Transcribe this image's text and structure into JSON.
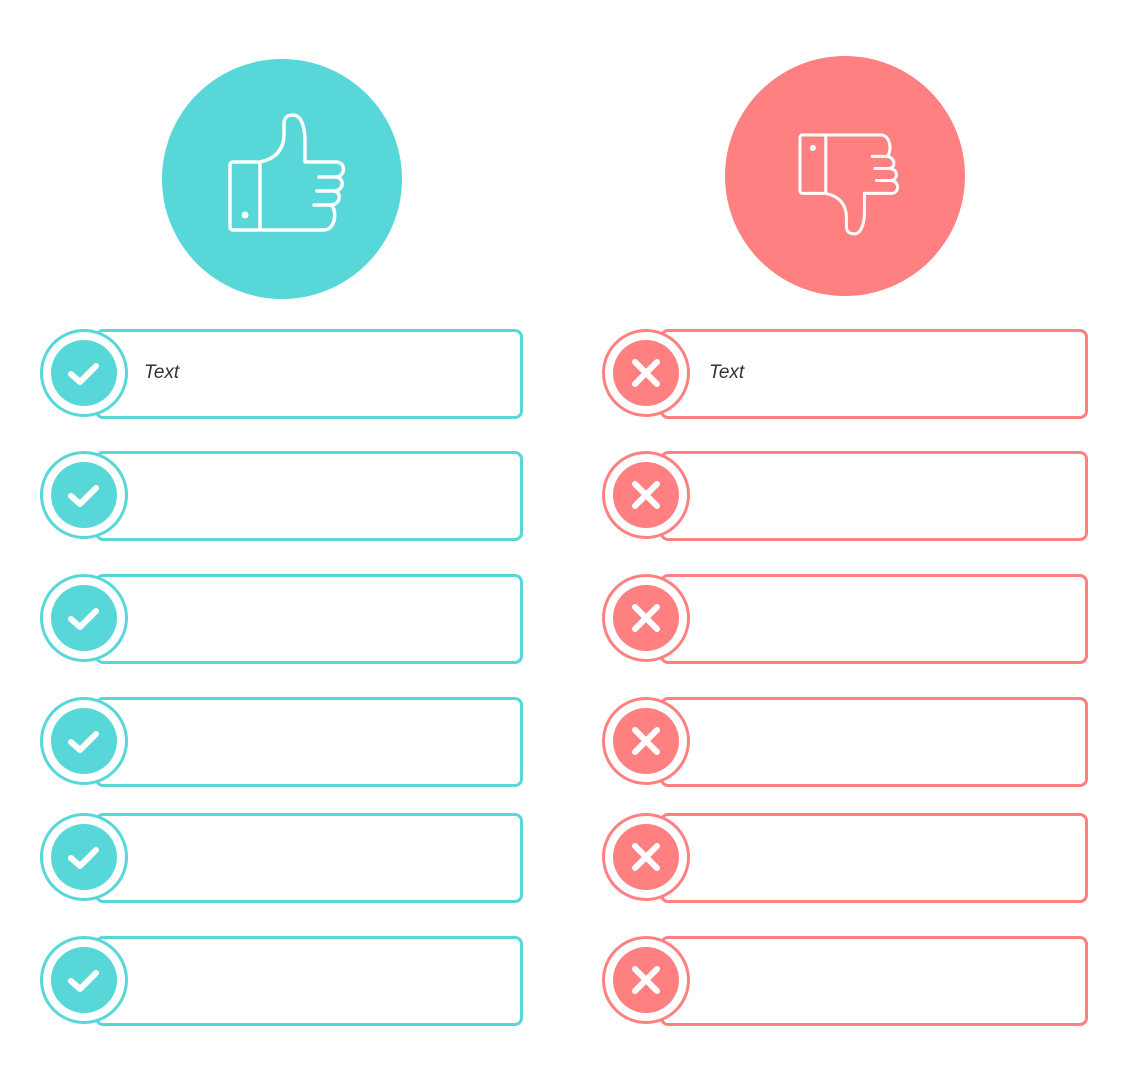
{
  "colors": {
    "pros": "#57D7D7",
    "cons": "#FF8080"
  },
  "pros": {
    "icon": "thumbs-up-icon",
    "item_icon": "check-icon",
    "items": [
      "Text",
      "",
      "",
      "",
      "",
      ""
    ]
  },
  "cons": {
    "icon": "thumbs-down-icon",
    "item_icon": "x-icon",
    "items": [
      "Text",
      "",
      "",
      "",
      "",
      ""
    ]
  }
}
